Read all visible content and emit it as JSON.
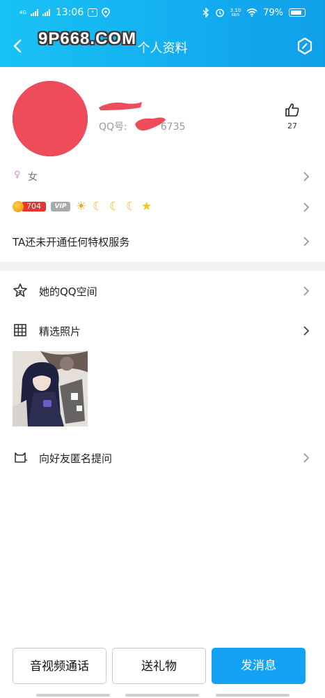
{
  "status_bar": {
    "network": "4G",
    "time": "13:06",
    "speed": "3.10",
    "speed_unit": "KB/S",
    "battery": "79%"
  },
  "header": {
    "title": "个人资料",
    "back_icon": "chevron-left-icon",
    "settings_icon": "hexagon-settings-icon"
  },
  "watermarks": {
    "top_left": "9P668.COM"
  },
  "profile": {
    "qq_label": "QQ号:",
    "qq_visible_suffix": "6735",
    "like_count": "27",
    "gender": "女",
    "charm_points": "704",
    "vip_label": "VIP",
    "level_icons": [
      "sun",
      "moon",
      "moon",
      "moon",
      "star"
    ],
    "privilege_text": "TA还未开通任何特权服务"
  },
  "menu": {
    "qzone": "她的QQ空间",
    "photos": "精选照片",
    "anonymous": "向好友匿名提问"
  },
  "actions": {
    "call": "音视频通话",
    "gift": "送礼物",
    "message": "发消息"
  },
  "colors": {
    "header_start": "#19c3f5",
    "header_end": "#0f9fe9",
    "primary_button": "#14a2f5",
    "redaction": "#ee4b5b"
  }
}
